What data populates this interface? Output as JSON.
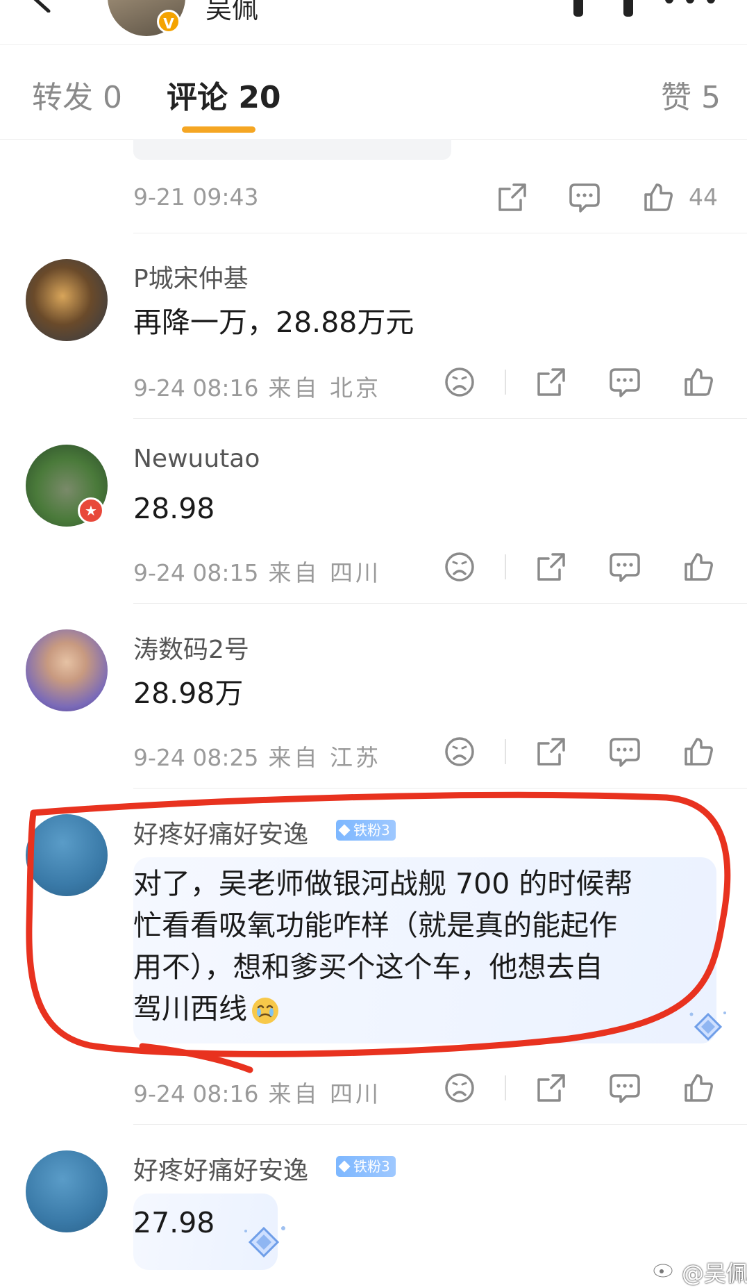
{
  "header": {
    "user_name": "吴佩"
  },
  "tabs": [
    {
      "label": "转发 0"
    },
    {
      "label": "评论 20"
    },
    {
      "label": "赞 5"
    }
  ],
  "prev_comment": {
    "time": "9-21 09:43",
    "likes": "44"
  },
  "comments": [
    {
      "user": "P城宋仲基",
      "text": "再降一万，28.88万元",
      "time": "9-24 08:16",
      "source": "来自 北京"
    },
    {
      "user": "Newuutao",
      "text": "28.98",
      "time": "9-24 08:15",
      "source": "来自 四川"
    },
    {
      "user": "涛数码2号",
      "text": "28.98万",
      "time": "9-24 08:25",
      "source": "来自 江苏"
    },
    {
      "user": "好疼好痛好安逸",
      "badge": "铁粉3",
      "lines": [
        "对了，吴老师做银河战舰 700 的时候帮",
        "忙看看吸氧功能咋样（就是真的能起作",
        "用不），想和爹买个这个车，他想去自",
        "驾川西线"
      ],
      "emoji": "crying-emoji",
      "time": "9-24 08:16",
      "source": "来自 四川"
    },
    {
      "user": "好疼好痛好安逸",
      "badge": "铁粉3",
      "text": "27.98"
    }
  ],
  "watermark": "@吴佩"
}
